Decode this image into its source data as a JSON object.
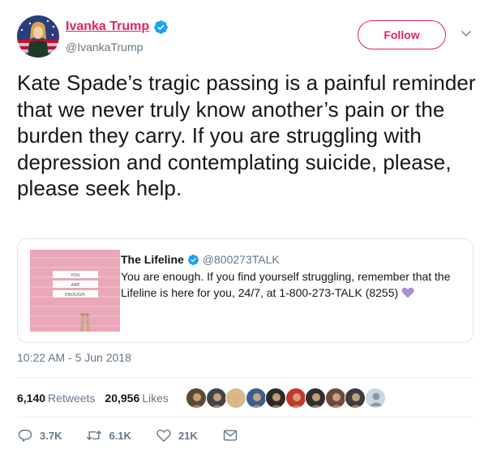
{
  "author": {
    "display_name": "Ivanka Trump",
    "handle": "@IvankaTrump",
    "verified": true,
    "accent_color": "#e0245e"
  },
  "follow_label": "Follow",
  "tweet": {
    "text": "Kate Spade’s tragic passing is a painful reminder that we never truly know another’s pain or the burden they carry. If you are struggling with depression and contemplating suicide, please, please seek help."
  },
  "quote": {
    "name": "The Lifeline",
    "handle": "@800273TALK",
    "verified": true,
    "text": "You are enough. If you find yourself struggling, remember that the Lifeline is here for you, 24/7, at 1-800-273-TALK (8255)",
    "emoji": "purple-heart-icon",
    "image_words": [
      "YOU",
      "ARE",
      "ENOUGH."
    ]
  },
  "timestamp": "10:22 AM - 5 Jun 2018",
  "stats": {
    "retweets_count": "6,140",
    "retweets_label": "Retweets",
    "likes_count": "20,956",
    "likes_label": "Likes"
  },
  "likers": [
    {
      "icon": "liker-avatar",
      "color": "#5a4a35"
    },
    {
      "icon": "liker-avatar",
      "color": "#444444"
    },
    {
      "icon": "liker-avatar",
      "color": "#d9b98a"
    },
    {
      "icon": "liker-avatar",
      "color": "#3a5f8a"
    },
    {
      "icon": "liker-avatar",
      "color": "#2b2b2b"
    },
    {
      "icon": "liker-avatar",
      "color": "#c0392b"
    },
    {
      "icon": "liker-avatar",
      "color": "#2e2e2e"
    },
    {
      "icon": "liker-avatar",
      "color": "#6b4a3a"
    },
    {
      "icon": "liker-avatar",
      "color": "#3c3c3c"
    },
    {
      "icon": "default-avatar",
      "color": "#ccd6dd"
    }
  ],
  "actions": {
    "reply_count": "3.7K",
    "retweet_count": "6.1K",
    "like_count": "21K"
  },
  "colors": {
    "link": "#1da1f2",
    "muted": "#657786",
    "pink_card": "#e9a7b7"
  }
}
